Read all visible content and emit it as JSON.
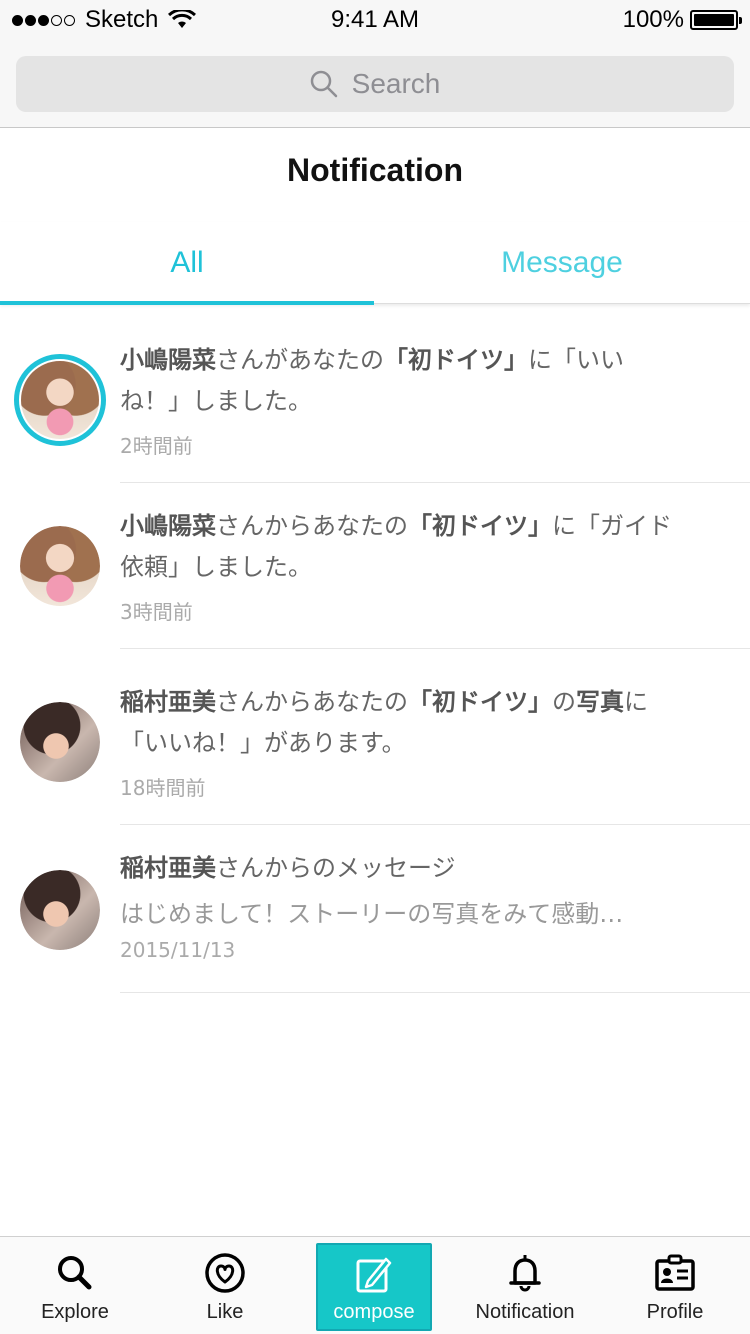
{
  "status_bar": {
    "carrier": "Sketch",
    "time": "9:41 AM",
    "battery": "100%"
  },
  "search": {
    "placeholder": "Search"
  },
  "page": {
    "title": "Notification"
  },
  "tabs": [
    {
      "label": "All",
      "active": true
    },
    {
      "label": "Message",
      "active": false
    }
  ],
  "notifications": [
    {
      "name": "小嶋陽菜",
      "pre": "さんがあなたの",
      "story": "「初ドイツ」",
      "post": "に「いいね！」しました。",
      "time": "2時間前"
    },
    {
      "name": "小嶋陽菜",
      "pre": "さんからあなたの",
      "story": "「初ドイツ」",
      "post": "に「ガイド依頼」しました。",
      "time": "3時間前"
    },
    {
      "name": "稲村亜美",
      "pre": "さんからあなたの",
      "story": "「初ドイツ」",
      "mid": "の",
      "bold2": "写真",
      "post": "に「いいね！」があります。",
      "time": "18時間前"
    },
    {
      "name": "稲村亜美",
      "pre": "さんからのメッセージ",
      "preview": "はじめまして！ストーリーの写真をみて感動…",
      "time": "2015/11/13"
    }
  ],
  "tabbar": [
    {
      "label": "Explore",
      "icon": "search-icon"
    },
    {
      "label": "Like",
      "icon": "heart-icon"
    },
    {
      "label": "compose",
      "icon": "compose-icon"
    },
    {
      "label": "Notification",
      "icon": "bell-icon"
    },
    {
      "label": "Profile",
      "icon": "profile-card-icon"
    }
  ],
  "colors": {
    "accent": "#1fc2d8",
    "compose_bg": "#16c7c8"
  }
}
